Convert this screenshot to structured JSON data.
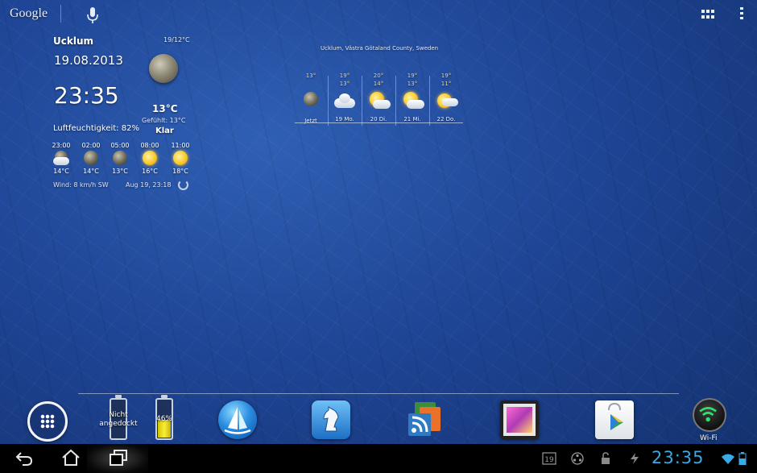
{
  "topbar": {
    "search_logo": "Google",
    "icons": [
      "microphone-icon",
      "all-apps-grid-icon",
      "overflow-menu-icon"
    ]
  },
  "clock_widget": {
    "city": "Ucklum",
    "date": "19.08.2013",
    "time": "23:35",
    "hi_lo": "19/12°C",
    "current_temp": "13°C",
    "feels_like": "Gefühlt: 13°C",
    "condition": "Klar",
    "humidity": "Luftfeuchtigkeit: 82%",
    "hourly": [
      {
        "time": "23:00",
        "temp": "14°C",
        "icon": "moon-cloud-icon"
      },
      {
        "time": "02:00",
        "temp": "14°C",
        "icon": "moon-icon"
      },
      {
        "time": "05:00",
        "temp": "13°C",
        "icon": "moon-icon"
      },
      {
        "time": "08:00",
        "temp": "16°C",
        "icon": "sun-icon"
      },
      {
        "time": "11:00",
        "temp": "18°C",
        "icon": "sun-icon"
      }
    ],
    "wind": "Wind: 8 km/h SW",
    "updated": "Aug 19, 23:18"
  },
  "forecast_widget": {
    "location": "Ucklum, Västra Götaland County, Sweden",
    "days": [
      {
        "hi": "13°",
        "lo": "",
        "day": "Jetzt",
        "icon": "moon-icon"
      },
      {
        "hi": "19°",
        "lo": "13°",
        "day": "19 Mo.",
        "icon": "cloud-icon"
      },
      {
        "hi": "20°",
        "lo": "14°",
        "day": "20 Di.",
        "icon": "sun-cloud-icon"
      },
      {
        "hi": "19°",
        "lo": "13°",
        "day": "21 Mi.",
        "icon": "sun-cloud-icon"
      },
      {
        "hi": "19°",
        "lo": "11°",
        "day": "22 Do.",
        "icon": "sun-cloud-icon"
      }
    ]
  },
  "dock": {
    "dock_battery_label": "Nicht angedockt",
    "battery_percent_label": "46%",
    "battery_level": 0.46,
    "wifi_label": "Wi-Fi"
  },
  "system_bar": {
    "clock": "23:35",
    "calendar_badge": "19",
    "accent_color": "#3aa9e8"
  }
}
